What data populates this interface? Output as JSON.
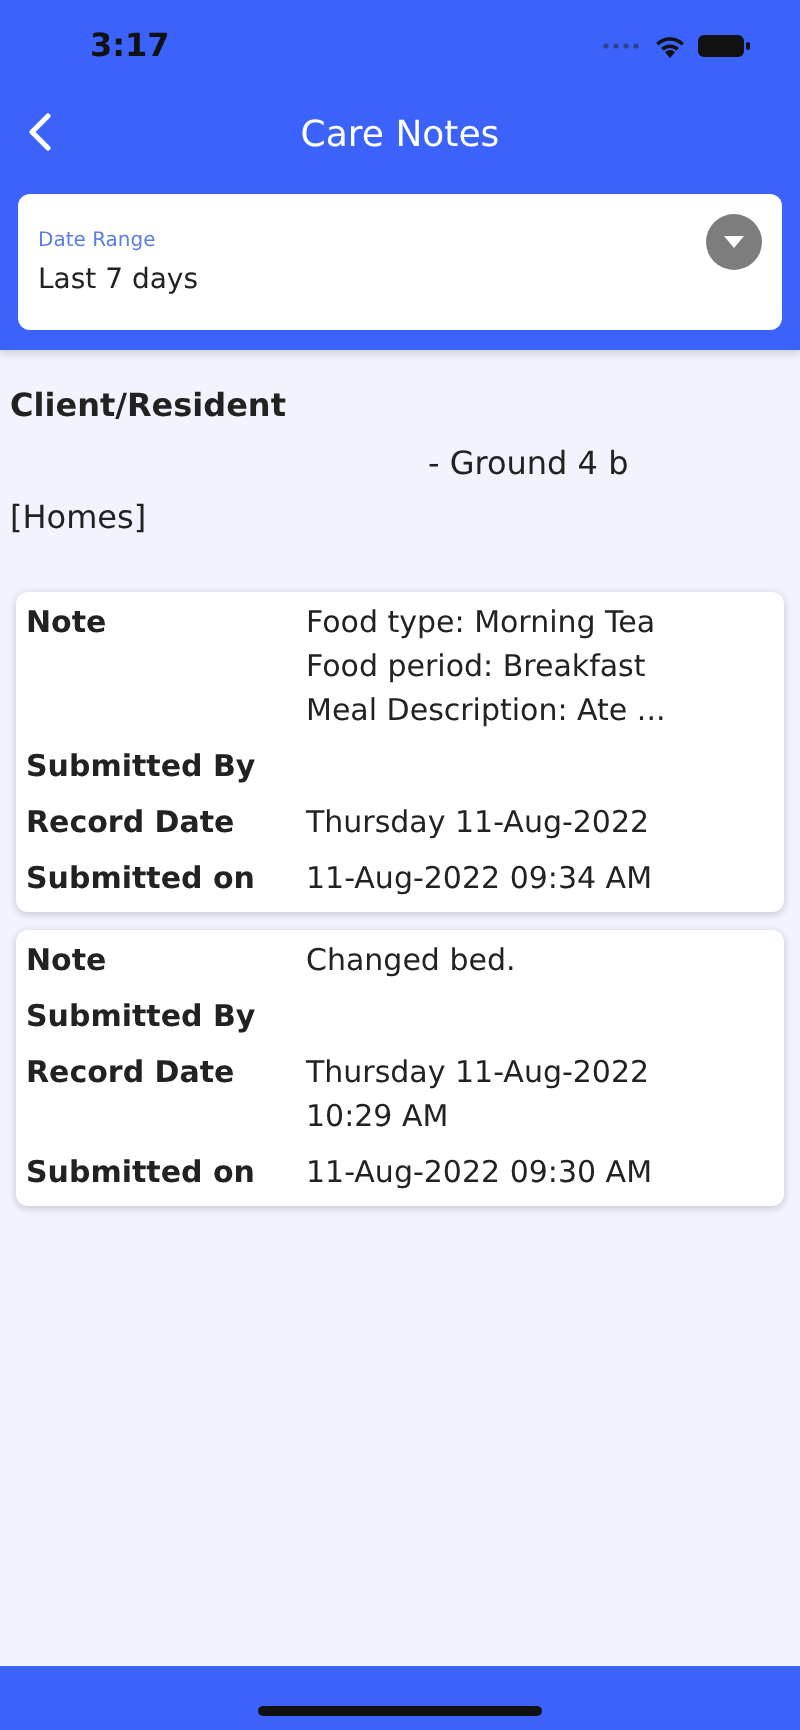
{
  "status_bar": {
    "time": "3:17"
  },
  "header": {
    "title": "Care Notes"
  },
  "date_range": {
    "label": "Date Range",
    "value": "Last 7 days"
  },
  "client": {
    "heading": "Client/Resident",
    "location": "- Ground 4 b",
    "facility": "[Homes]"
  },
  "notes": [
    {
      "rows": [
        {
          "label": "Note",
          "lines": [
            "Food type: Morning Tea",
            "Food period: Breakfast",
            "Meal Description: Ate ..."
          ]
        },
        {
          "label": "Submitted By",
          "lines": []
        },
        {
          "label": "Record Date",
          "lines": [
            "Thursday 11-Aug-2022"
          ]
        },
        {
          "label": "Submitted on",
          "lines": [
            "11-Aug-2022 09:34 AM"
          ]
        }
      ]
    },
    {
      "rows": [
        {
          "label": "Note",
          "lines": [
            "Changed bed."
          ]
        },
        {
          "label": "Submitted By",
          "lines": []
        },
        {
          "label": "Record Date",
          "lines": [
            "Thursday 11-Aug-2022",
            "10:29 AM"
          ]
        },
        {
          "label": "Submitted on",
          "lines": [
            "11-Aug-2022 09:30 AM"
          ]
        }
      ]
    }
  ]
}
